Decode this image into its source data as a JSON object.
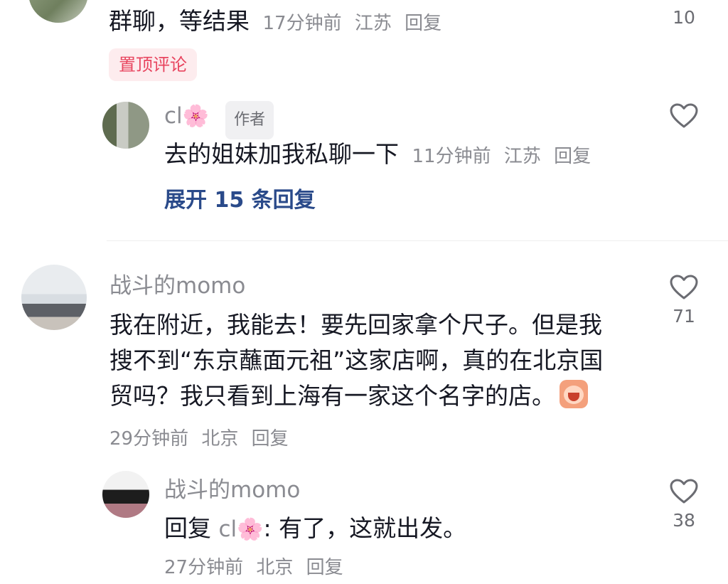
{
  "comment1": {
    "text_tail": "群聊，等结果",
    "time": "17分钟前",
    "location": "江苏",
    "reply_label": "回复",
    "like_count": "10",
    "pinned_label": "置顶评论"
  },
  "reply1": {
    "username": "cl",
    "username_emoji": "🌸",
    "author_badge": "作者",
    "text": "去的姐妹加我私聊一下",
    "time": "11分钟前",
    "location": "江苏",
    "reply_label": "回复",
    "expand_label": "展开 15 条回复"
  },
  "comment2": {
    "username": "战斗的momo",
    "text_line1": "我在附近，我能去！要先回家拿个尺子。但是我",
    "text_line2": "搜不到“东京蘸面元祖”这家店啊，真的在北京国",
    "text_line3": "贸吗？我只看到上海有一家这个名字的店。",
    "time": "29分钟前",
    "location": "北京",
    "reply_label": "回复",
    "like_count": "71"
  },
  "reply2": {
    "username": "战斗的momo",
    "reply_prefix": "回复 ",
    "reply_to": "cl",
    "reply_to_emoji": "🌸",
    "text": ": 有了，这就出发。",
    "time": "27分钟前",
    "location": "北京",
    "reply_label": "回复",
    "like_count": "38"
  },
  "icons": {
    "like": "heart-outline-icon",
    "emoji_sticker": "crying-face-sticker-icon"
  },
  "colors": {
    "text_primary": "#161823",
    "text_secondary": "#8a8b91",
    "pinned_bg": "#fdecee",
    "pinned_fg": "#e8455f",
    "expand_link": "#2a4a8a"
  }
}
